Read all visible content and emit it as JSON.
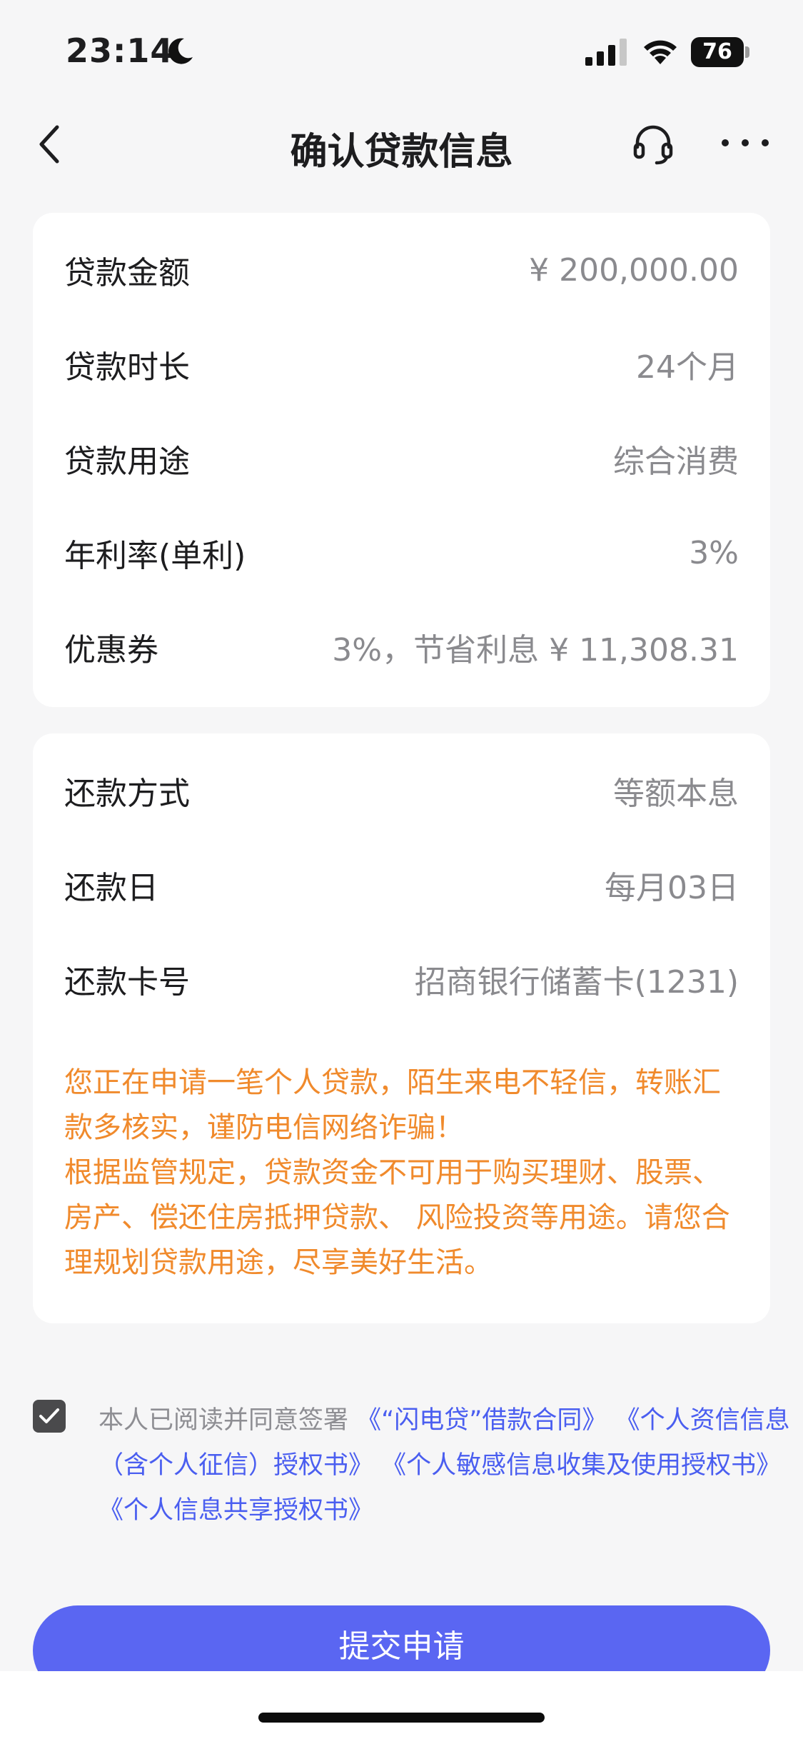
{
  "status_bar": {
    "time": "23:14",
    "battery_level": "76",
    "icons": [
      "moon-icon",
      "signal-icon",
      "wifi-icon",
      "battery-icon"
    ]
  },
  "nav": {
    "title": "确认贷款信息",
    "icons": [
      "back-chevron-icon",
      "headset-icon",
      "more-icon"
    ]
  },
  "loan_info": [
    {
      "label": "贷款金额",
      "value": "¥ 200,000.00"
    },
    {
      "label": "贷款时长",
      "value": "24个月"
    },
    {
      "label": "贷款用途",
      "value": "综合消费"
    },
    {
      "label": "年利率(单利)",
      "value": "3%"
    },
    {
      "label": "优惠券",
      "value": "3%，节省利息 ¥ 11,308.31"
    }
  ],
  "repayment_info": [
    {
      "label": "还款方式",
      "value": "等额本息"
    },
    {
      "label": "还款日",
      "value": "每月03日"
    },
    {
      "label": "还款卡号",
      "value": "招商银行储蓄卡(1231)"
    }
  ],
  "notice": {
    "line1": "您正在申请一笔个人贷款，陌生来电不轻信，转账汇款多核实，谨防电信网络诈骗！",
    "line2": "根据监管规定，贷款资金不可用于购买理财、股票、房产、偿还住房抵押贷款、 风险投资等用途。请您合理规划贷款用途，尽享美好生活。"
  },
  "agreement": {
    "checked": true,
    "prefix": "本人已阅读并同意签署",
    "docs": [
      "《“闪电贷”借款合同》",
      "《个人资信信息（含个人征信）授权书》",
      "《个人敏感信息收集及使用授权书》",
      "《个人信息共享授权书》"
    ]
  },
  "submit_label": "提交申请",
  "colors": {
    "accent": "#5a66f2",
    "link": "#4a5ef0",
    "notice": "#f08a2c",
    "background": "#f6f6f7"
  }
}
